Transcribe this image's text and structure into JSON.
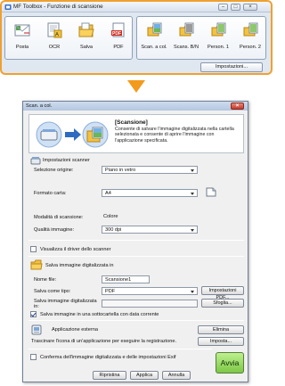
{
  "toolbox": {
    "title": "MF Toolbox - Funzione di scansione",
    "buttons": [
      {
        "label": "Posta",
        "icon": "mail-icon"
      },
      {
        "label": "OCR",
        "icon": "ocr-icon"
      },
      {
        "label": "Salva",
        "icon": "folder-save-icon"
      },
      {
        "label": "PDF",
        "icon": "pdf-icon"
      },
      {
        "label": "Scan. a col.",
        "icon": "scan-color-icon"
      },
      {
        "label": "Scans. B/N",
        "icon": "scan-bw-icon"
      },
      {
        "label": "Person. 1",
        "icon": "custom1-icon"
      },
      {
        "label": "Person. 2",
        "icon": "custom2-icon"
      }
    ],
    "settings_label": "Impostazioni..."
  },
  "dialog": {
    "title": "Scan. a col.",
    "header_name": "[Scansione]",
    "header_desc": "Consente di salvare l'immagine digitalizzata nella cartella selezionata e consente di aprire l'immagine con l'applicazione specificata.",
    "scanner_section": "Impostazioni scanner",
    "source_label": "Selezione origine:",
    "source_value": "Piano in vetro",
    "paper_label": "Formato carta:",
    "paper_value": "A4",
    "mode_label": "Modalità di scansione:",
    "mode_value": "Colore",
    "quality_label": "Qualità immagine:",
    "quality_value": "300 dpi",
    "show_driver_label": "Visualizza il driver dello scanner",
    "save_section": "Salva immagine digitalizzata in",
    "filename_label": "Nome file:",
    "filename_value": "Scansione1",
    "saveas_label": "Salva come tipo:",
    "saveas_value": "PDF",
    "pdf_settings_button": "Impostazioni PDF...",
    "savein_label": "Salva immagine digitalizzata in:",
    "browse_button": "Sfoglia...",
    "subfolder_label": "Salva immagine in una sottocartella con data corrente",
    "app_section": "Applicazione esterna",
    "remove_button": "Elimina",
    "app_hint": "Trascinare l'icona di un'applicazione per eseguire la registrazione.",
    "set_button": "Imposta...",
    "confirm_label": "Conferma dell'immagine digitalizzata e delle impostazioni Exif",
    "restore_button": "Ripristina",
    "apply_button": "Applica",
    "cancel_button": "Annulla",
    "start_button": "Avvia"
  },
  "colors": {
    "highlight_orange": "#f0a030",
    "arrow_orange": "#f39a1c",
    "start_green": "#8fd35a"
  }
}
